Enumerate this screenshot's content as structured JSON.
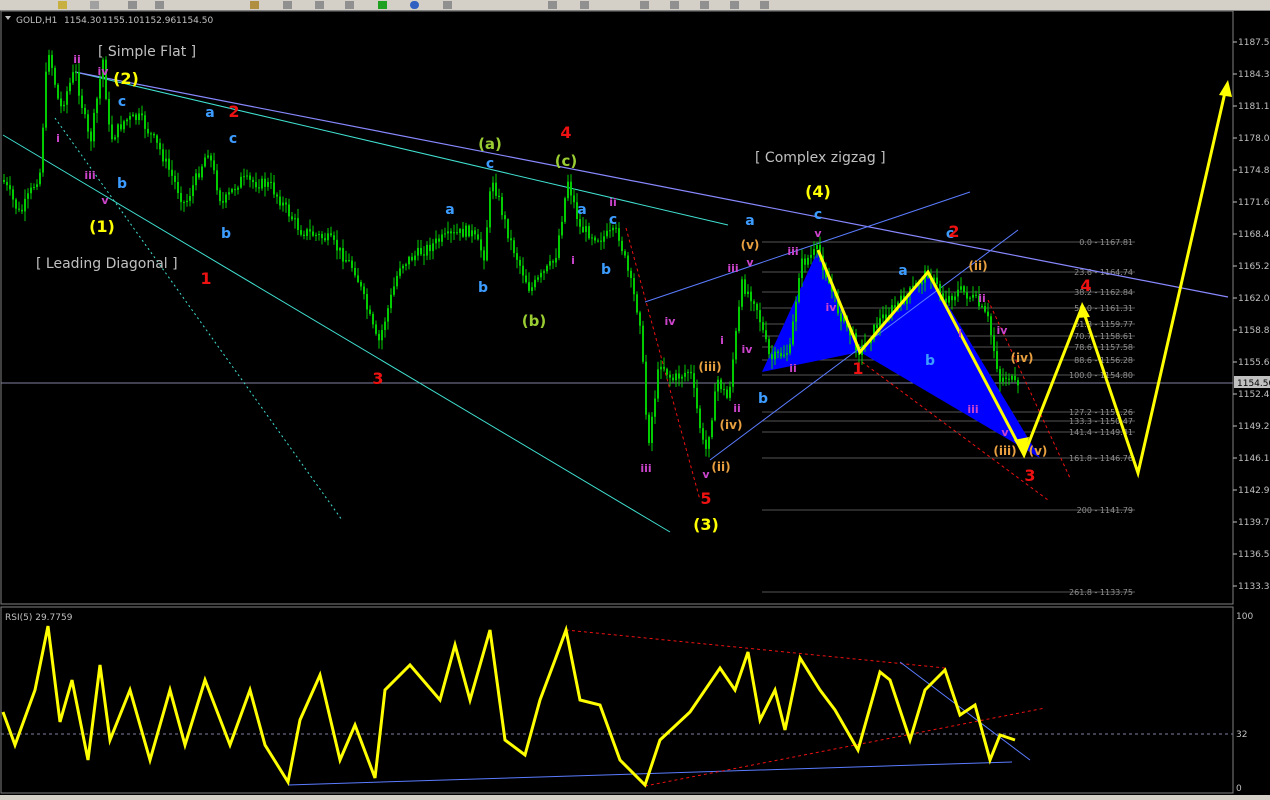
{
  "window": {
    "symbol_label": "GOLD,H1",
    "ohlc": [
      "1154.30",
      "1155.10",
      "1152.96",
      "1154.50"
    ],
    "current_price": "1154.50"
  },
  "price_axis": {
    "labels": [
      "1187.57",
      "1184.37",
      "1181.17",
      "1178.02",
      "1174.82",
      "1171.62",
      "1168.42",
      "1165.22",
      "1162.07",
      "1158.87",
      "1155.67",
      "1152.47",
      "1149.27",
      "1146.12",
      "1142.92",
      "1139.72",
      "1136.52",
      "1133.37"
    ]
  },
  "rsi": {
    "label": "RSI(5) 29.7759",
    "levels": [
      "100",
      "32",
      "0"
    ]
  },
  "annotations": {
    "simple_flat": "[ Simple Flat ]",
    "leading_diagonal": "[ Leading Diagonal ]",
    "complex_zigzag": "[ Complex zigzag ]",
    "wave_labels": [
      {
        "t": "(2)",
        "c": "#ffff00"
      },
      {
        "t": "c",
        "c": "#3d9cff"
      },
      {
        "t": "b",
        "c": "#3d9cff"
      },
      {
        "t": "(1)",
        "c": "#ffff00"
      },
      {
        "t": "ii",
        "c": "#cc44cc"
      },
      {
        "t": "iv",
        "c": "#cc44cc"
      },
      {
        "t": "i",
        "c": "#cc44cc"
      },
      {
        "t": "iii",
        "c": "#cc44cc"
      },
      {
        "t": "v",
        "c": "#cc44cc"
      },
      {
        "t": "a",
        "c": "#3d9cff"
      },
      {
        "t": "2",
        "c": "#ee1111"
      },
      {
        "t": "c",
        "c": "#3d9cff"
      },
      {
        "t": "b",
        "c": "#3d9cff"
      },
      {
        "t": "1",
        "c": "#ee1111"
      },
      {
        "t": "3",
        "c": "#ee1111"
      },
      {
        "t": "a",
        "c": "#3d9cff"
      },
      {
        "t": "b",
        "c": "#3d9cff"
      },
      {
        "t": "(a)",
        "c": "#9acd32"
      },
      {
        "t": "c",
        "c": "#3d9cff"
      },
      {
        "t": "(b)",
        "c": "#9acd32"
      },
      {
        "t": "4",
        "c": "#ee1111"
      },
      {
        "t": "(c)",
        "c": "#9acd32"
      },
      {
        "t": "a",
        "c": "#3d9cff"
      },
      {
        "t": "i",
        "c": "#cc44cc"
      },
      {
        "t": "b",
        "c": "#3d9cff"
      },
      {
        "t": "c",
        "c": "#3d9cff"
      },
      {
        "t": "ii",
        "c": "#cc44cc"
      },
      {
        "t": "iv",
        "c": "#cc44cc"
      },
      {
        "t": "iii",
        "c": "#cc44cc"
      },
      {
        "t": "5",
        "c": "#ee1111"
      },
      {
        "t": "(3)",
        "c": "#ffff00"
      },
      {
        "t": "v",
        "c": "#cc44cc"
      },
      {
        "t": "(ii)",
        "c": "#e8a040"
      },
      {
        "t": "(iv)",
        "c": "#e8a040"
      },
      {
        "t": "(iii)",
        "c": "#e8a040"
      },
      {
        "t": "ii",
        "c": "#cc44cc"
      },
      {
        "t": "i",
        "c": "#cc44cc"
      },
      {
        "t": "iii",
        "c": "#cc44cc"
      },
      {
        "t": "iv",
        "c": "#cc44cc"
      },
      {
        "t": "b",
        "c": "#3d9cff"
      },
      {
        "t": "a",
        "c": "#3d9cff"
      },
      {
        "t": "(v)",
        "c": "#e8a040"
      },
      {
        "t": "v",
        "c": "#cc44cc"
      },
      {
        "t": "iii",
        "c": "#cc44cc"
      },
      {
        "t": "(4)",
        "c": "#ffff00"
      },
      {
        "t": "c",
        "c": "#3d9cff"
      },
      {
        "t": "v",
        "c": "#cc44cc"
      },
      {
        "t": "iv",
        "c": "#cc44cc"
      },
      {
        "t": "ii",
        "c": "#cc44cc"
      },
      {
        "t": "1",
        "c": "#ee1111"
      },
      {
        "t": "a",
        "c": "#3d9cff"
      },
      {
        "t": "b",
        "c": "#3d9cff"
      },
      {
        "t": "c",
        "c": "#3d9cff"
      },
      {
        "t": "2",
        "c": "#ee1111"
      },
      {
        "t": "(ii)",
        "c": "#e8a040"
      },
      {
        "t": "i",
        "c": "#cc44cc"
      },
      {
        "t": "ii",
        "c": "#cc44cc"
      },
      {
        "t": "iv",
        "c": "#cc44cc"
      },
      {
        "t": "(iv)",
        "c": "#e8a040"
      },
      {
        "t": "iii",
        "c": "#cc44cc"
      },
      {
        "t": "v",
        "c": "#cc44cc"
      },
      {
        "t": "(iii)",
        "c": "#e8a040"
      },
      {
        "t": "(v)",
        "c": "#e8a040"
      },
      {
        "t": "3",
        "c": "#ee1111"
      },
      {
        "t": "4",
        "c": "#ee1111"
      }
    ]
  },
  "fib_levels": [
    "0.0 - 1167.81",
    "23.6 - 1164.74",
    "38.2 - 1162.84",
    "50.0 - 1161.31",
    "61.8 - 1159.77",
    "70.7 - 1158.61",
    "78.6 - 1157.58",
    "88.6 - 1156.28",
    "100.0 - 1154.80",
    "127.2 - 1151.26",
    "133.3 - 1150.47",
    "141.4 - 1149.41",
    "161.8 - 1146.76",
    "200 - 1141.79",
    "261.8 - 1133.75"
  ],
  "colors": {
    "background": "#000000",
    "candle": "#00cc00",
    "rsi_line": "#ffff00",
    "harmonic_fill": "#0000ff",
    "projection": "#ffff00",
    "text": "#c0c0c0"
  }
}
